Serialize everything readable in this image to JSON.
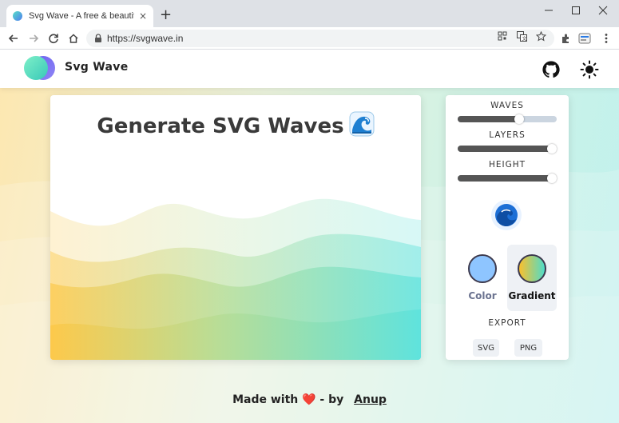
{
  "browser": {
    "tab_title": "Svg Wave - A free & beautiful g",
    "url": "https://svgwave.in",
    "new_tab": "+",
    "tab_close": "×"
  },
  "app": {
    "brand": "Svg Wave",
    "title": "Generate SVG Waves",
    "title_emoji": "wave-emoji"
  },
  "panel": {
    "waves_label": "WAVES",
    "layers_label": "LAYERS",
    "height_label": "HEIGHT",
    "waves_value": 0.62,
    "layers_value": 0.95,
    "height_value": 0.95,
    "color_label": "Color",
    "gradient_label": "Gradient",
    "export_label": "EXPORT",
    "svg_button": "SVG",
    "png_button": "PNG",
    "solid_color": "#8ec5ff",
    "gradient_colors": [
      "#fbc02d",
      "#4fdcc9"
    ],
    "active_mode": "gradient"
  },
  "footer": {
    "made_with": "Made with",
    "heart": "❤️",
    "by": "- by",
    "author": "Anup"
  },
  "colors": {
    "wave_start": "#fdc94b",
    "wave_end": "#5fe3dd",
    "accent_dark": "#3d3a4e"
  }
}
